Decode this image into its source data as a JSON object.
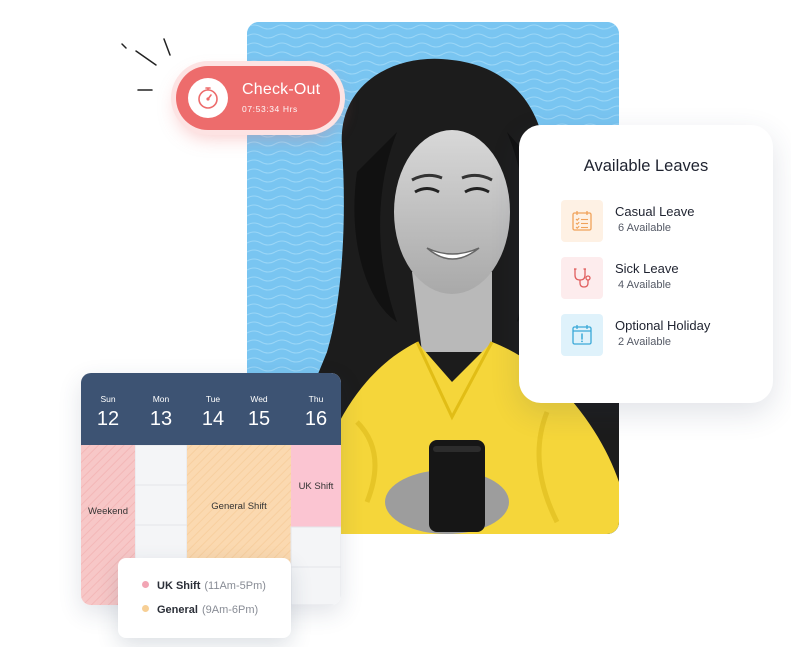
{
  "checkout": {
    "label": "Check-Out",
    "time": "07:53:34 Hrs",
    "icon": "stopwatch-icon",
    "color": "#ed6c6c"
  },
  "leaves": {
    "title": "Available Leaves",
    "items": [
      {
        "name": "Casual Leave",
        "count": "6 Available",
        "icon": "checklist-calendar-icon",
        "color": "#f0a25a"
      },
      {
        "name": "Sick Leave",
        "count": "4 Available",
        "icon": "stethoscope-icon",
        "color": "#e05e5e"
      },
      {
        "name": "Optional Holiday",
        "count": "2 Available",
        "icon": "alert-calendar-icon",
        "color": "#3aa9d8"
      }
    ]
  },
  "calendar": {
    "days": [
      {
        "name": "Sun",
        "num": "12"
      },
      {
        "name": "Mon",
        "num": "13"
      },
      {
        "name": "Tue",
        "num": "14"
      },
      {
        "name": "Wed",
        "num": "15"
      },
      {
        "name": "Thu",
        "num": "16"
      }
    ],
    "shifts": {
      "weekend": "Weekend",
      "general": "General Shift",
      "uk": "UK Shift"
    }
  },
  "legend": [
    {
      "name": "UK Shift",
      "hours": "(11Am-5Pm)",
      "color": "#f2a5b4"
    },
    {
      "name": "General",
      "hours": "(9Am-6Pm)",
      "color": "#f7cf95"
    }
  ]
}
